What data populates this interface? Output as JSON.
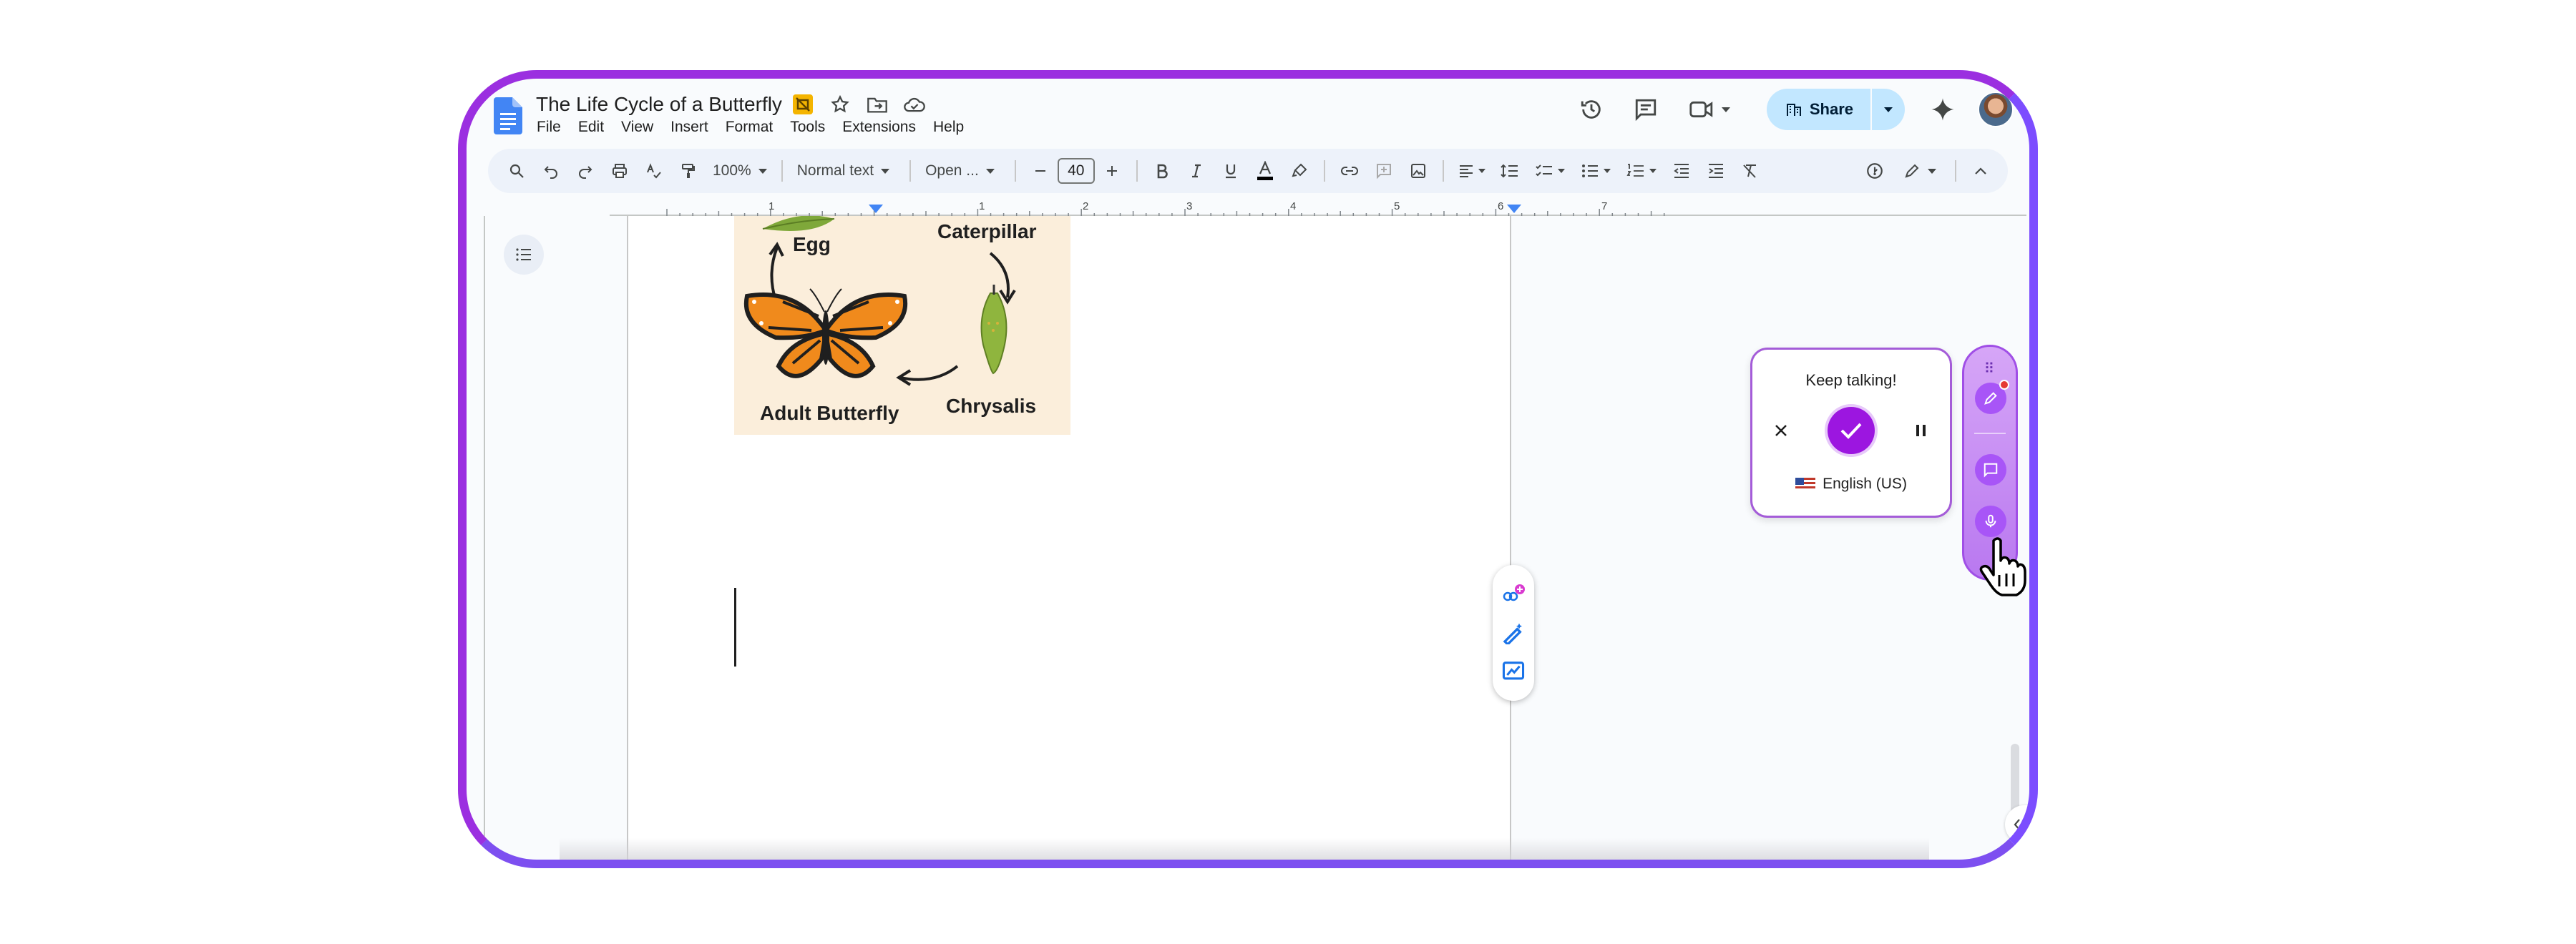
{
  "document": {
    "title": "The Life Cycle of a Butterfly"
  },
  "menu": [
    "File",
    "Edit",
    "View",
    "Insert",
    "Format",
    "Tools",
    "Extensions",
    "Help"
  ],
  "header": {
    "share_label": "Share"
  },
  "toolbar": {
    "zoom": "100%",
    "style": "Normal text",
    "font": "Open ...",
    "font_size": "40"
  },
  "ruler": {
    "marks": [
      "1",
      "1",
      "2",
      "3",
      "4",
      "5",
      "6",
      "7"
    ]
  },
  "image": {
    "labels": {
      "egg": "Egg",
      "caterpillar": "Caterpillar",
      "chrysalis": "Chrysalis",
      "adult": "Adult Butterfly"
    }
  },
  "voice": {
    "status": "Keep talking!",
    "language": "English (US)"
  },
  "colors": {
    "accent_purple": "#9c16e0",
    "share_bg": "#c2e7ff",
    "docs_blue": "#4285f4"
  }
}
